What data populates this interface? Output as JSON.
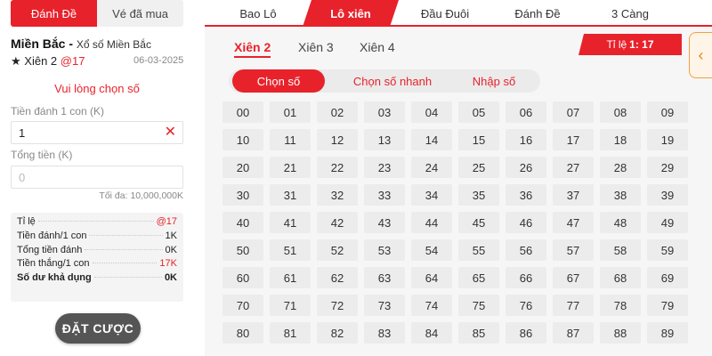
{
  "left_panel": {
    "tabs": [
      {
        "label": "Đánh Đề",
        "active": true
      },
      {
        "label": "Vé đã mua",
        "active": false
      }
    ],
    "region_name": "Miền Bắc -",
    "region_sub": "Xổ số Miền Bắc",
    "bet_type_star": "★",
    "bet_type": "Xiên 2",
    "bet_rate": "@17",
    "date": "06-03-2025",
    "prompt": "Vui lòng chọn số",
    "stake_label": "Tiền đánh 1 con (K)",
    "stake_value": "1",
    "clear_icon": "✕",
    "total_label": "Tổng tiền (K)",
    "total_placeholder": "0",
    "max_note": "Tối đa: 10,000,000K",
    "summary": [
      {
        "key": "Tỉ lệ",
        "value": "@17",
        "red": true,
        "bold": false
      },
      {
        "key": "Tiền đánh/1 con",
        "value": "1K",
        "red": false,
        "bold": false
      },
      {
        "key": "Tổng tiền đánh",
        "value": "0K",
        "red": false,
        "bold": false
      },
      {
        "key": "Tiền thắng/1 con",
        "value": "17K",
        "red": true,
        "bold": false
      },
      {
        "key": "Số dư khả dụng",
        "value": "0K",
        "red": false,
        "bold": true
      }
    ],
    "place_bet_label": "ĐẶT CƯỢC"
  },
  "right_panel": {
    "top_tabs": [
      {
        "label": "Bao Lô",
        "active": false
      },
      {
        "label": "Lô xiên",
        "active": true
      },
      {
        "label": "Đầu Đuôi",
        "active": false
      },
      {
        "label": "Đánh Đề",
        "active": false
      },
      {
        "label": "3 Càng",
        "active": false
      }
    ],
    "sub_tabs": [
      {
        "label": "Xiên 2",
        "active": true
      },
      {
        "label": "Xiên 3",
        "active": false
      },
      {
        "label": "Xiên 4",
        "active": false
      }
    ],
    "ratio_label": "Tỉ lệ",
    "ratio_value": "1: 17",
    "modes": [
      {
        "label": "Chọn số",
        "active": true
      },
      {
        "label": "Chọn số nhanh",
        "active": false
      },
      {
        "label": "Nhập số",
        "active": false
      }
    ],
    "side_handle_icon": "‹",
    "numbers": [
      "00",
      "01",
      "02",
      "03",
      "04",
      "05",
      "06",
      "07",
      "08",
      "09",
      "10",
      "11",
      "12",
      "13",
      "14",
      "15",
      "16",
      "17",
      "18",
      "19",
      "20",
      "21",
      "22",
      "23",
      "24",
      "25",
      "26",
      "27",
      "28",
      "29",
      "30",
      "31",
      "32",
      "33",
      "34",
      "35",
      "36",
      "37",
      "38",
      "39",
      "40",
      "41",
      "42",
      "43",
      "44",
      "45",
      "46",
      "47",
      "48",
      "49",
      "50",
      "51",
      "52",
      "53",
      "54",
      "55",
      "56",
      "57",
      "58",
      "59",
      "60",
      "61",
      "62",
      "63",
      "64",
      "65",
      "66",
      "67",
      "68",
      "69",
      "70",
      "71",
      "72",
      "73",
      "74",
      "75",
      "76",
      "77",
      "78",
      "79",
      "80",
      "81",
      "82",
      "83",
      "84",
      "85",
      "86",
      "87",
      "88",
      "89"
    ]
  },
  "colors": {
    "accent": "#e8222b",
    "button_dark": "#555555",
    "cell_bg": "#ececec",
    "handle": "#e28a1e"
  }
}
